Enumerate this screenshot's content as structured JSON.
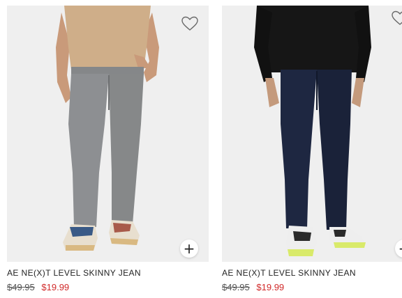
{
  "products": [
    {
      "name": "AE NE(X)T LEVEL SKINNY JEAN",
      "original_price": "$49.95",
      "sale_price": "$19.99",
      "quick_add_symbol": "+",
      "icons": [
        "heart-outline-icon",
        "plus-icon"
      ],
      "colors": {
        "top": "#cfae89",
        "jeans": "#8d8f92",
        "background": "#efefef"
      }
    },
    {
      "name": "AE NE(X)T LEVEL SKINNY JEAN",
      "original_price": "$49.95",
      "sale_price": "$19.99",
      "quick_add_symbol": "+",
      "icons": [
        "heart-outline-icon",
        "plus-icon"
      ],
      "colors": {
        "top": "#161616",
        "jeans": "#1e2741",
        "background": "#efefef"
      }
    }
  ],
  "colors": {
    "sale_price": "#d12a2a",
    "text": "#222222"
  }
}
